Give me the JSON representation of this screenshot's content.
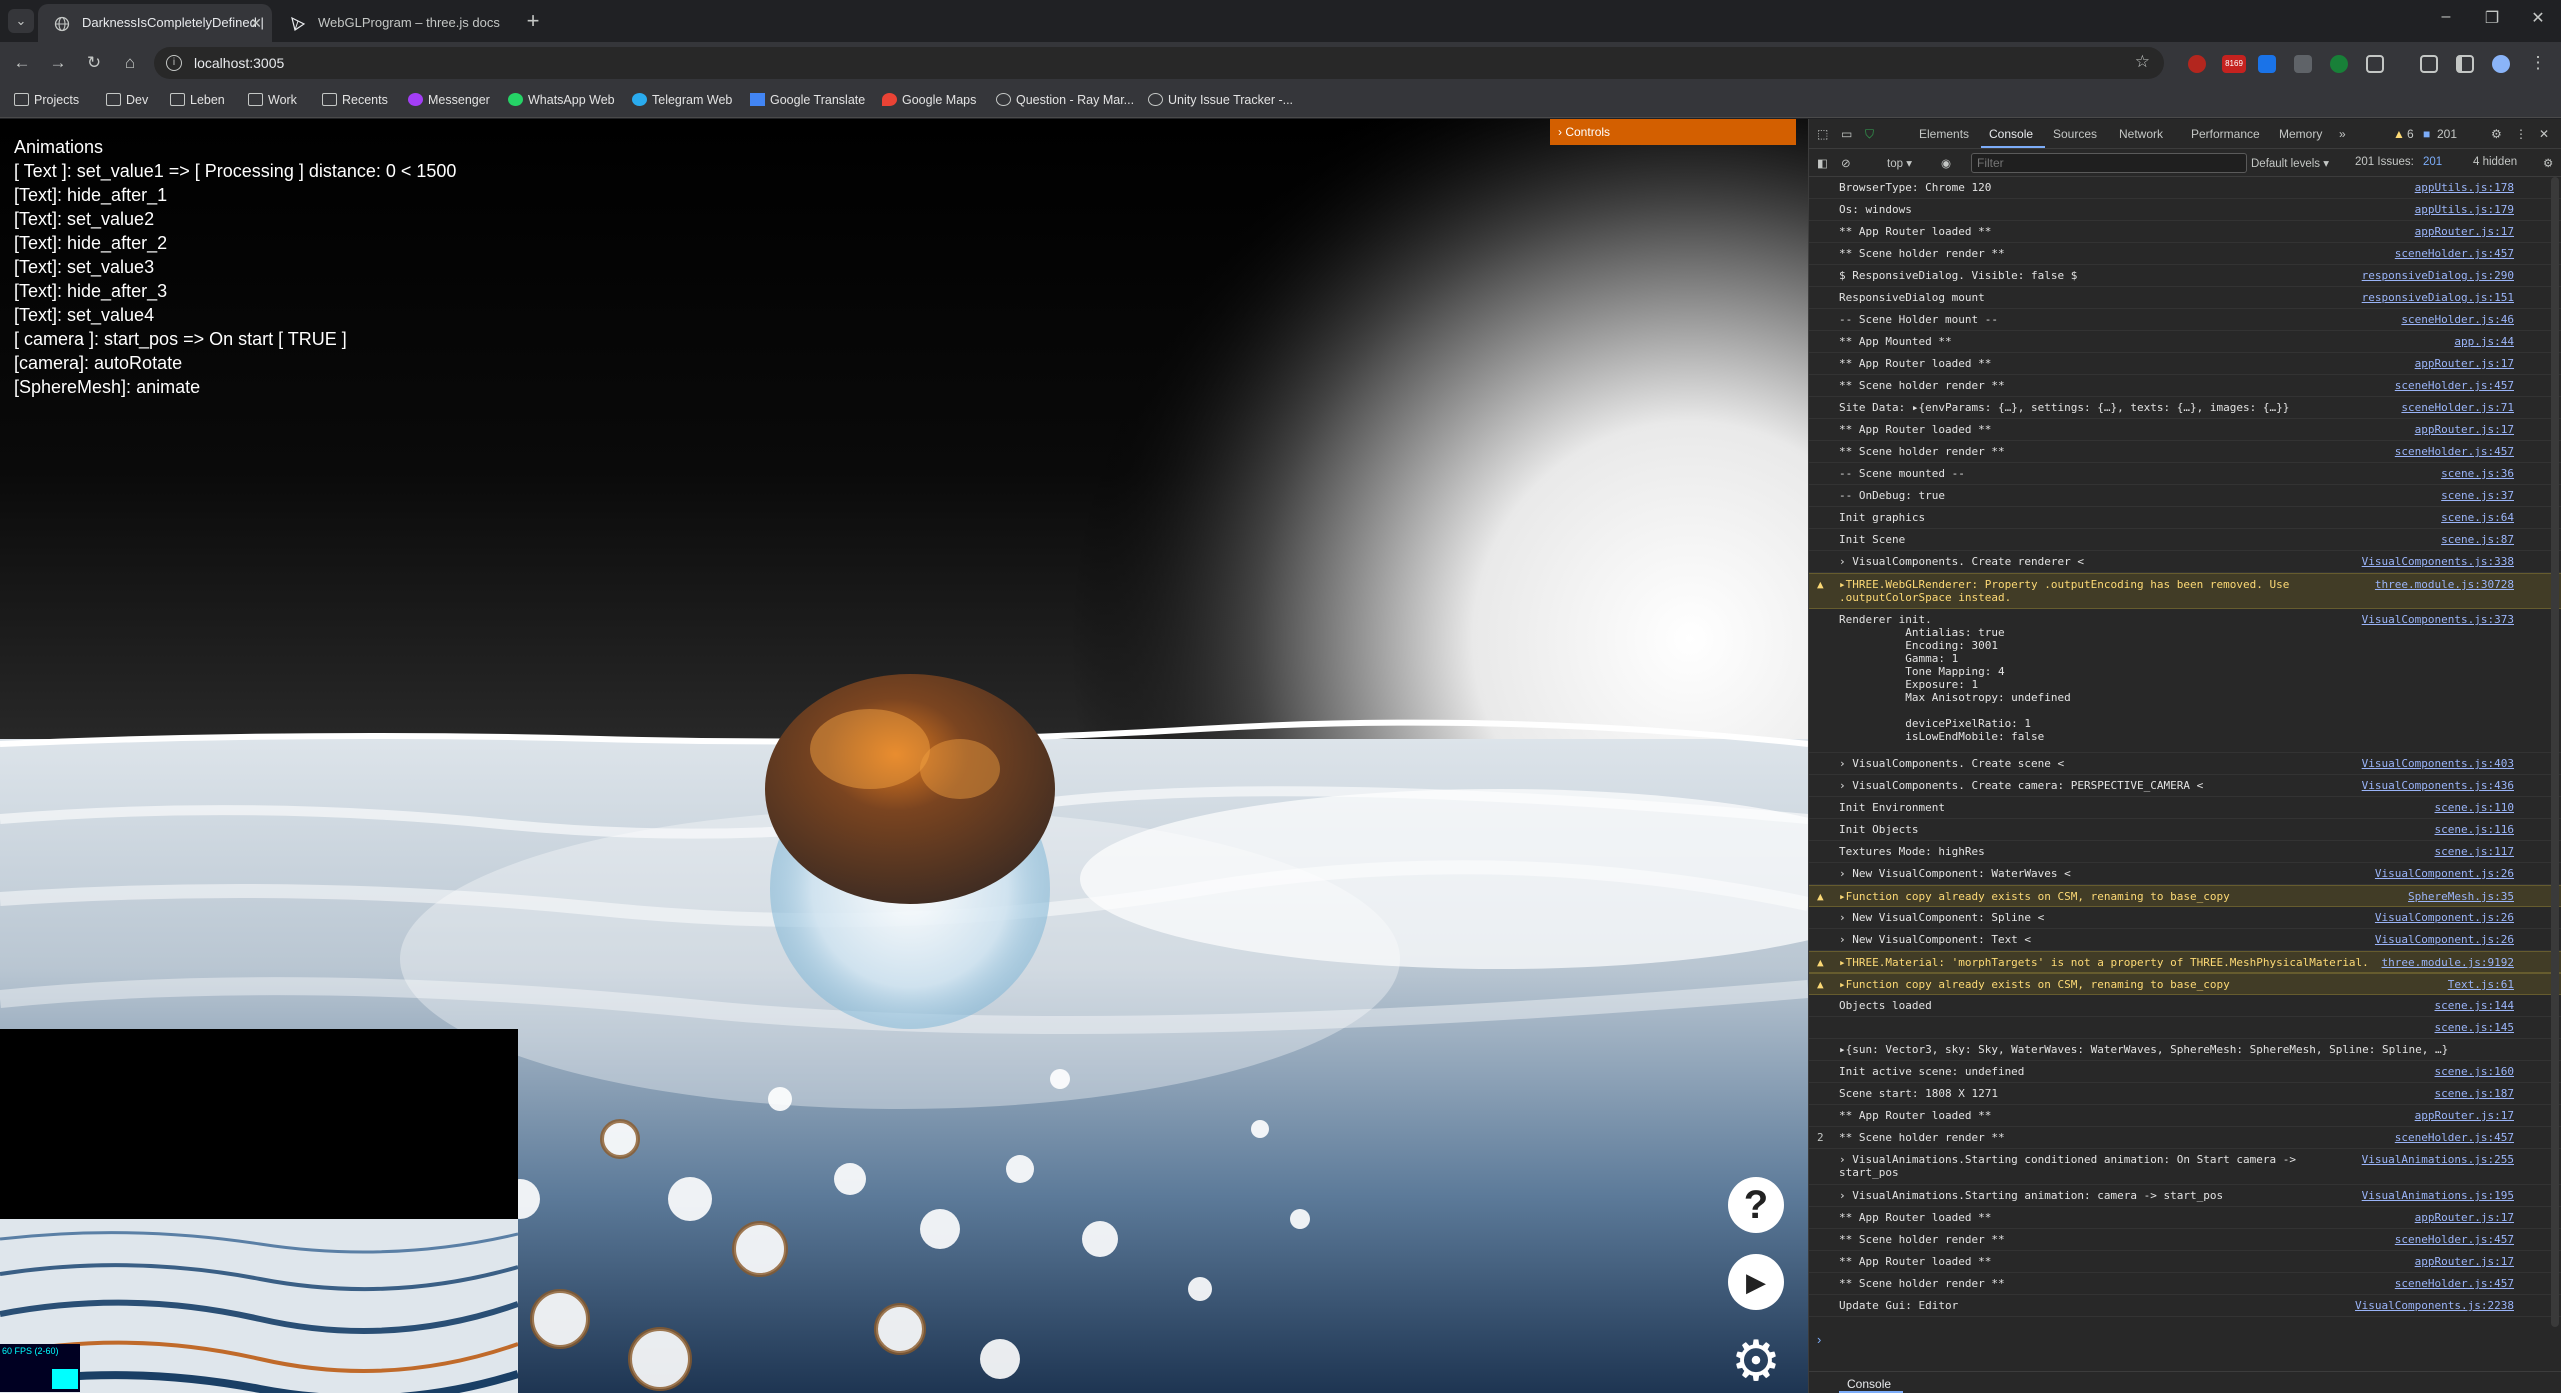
{
  "browser": {
    "tabs": [
      {
        "title": "DarknessIsCompletelyDefined |",
        "active": true
      },
      {
        "title": "WebGLProgram – three.js docs",
        "active": false
      }
    ],
    "url": "localhost:3005",
    "bookmarks": [
      {
        "label": "Projects",
        "icon": "folder-icon"
      },
      {
        "label": "Dev",
        "icon": "folder-icon"
      },
      {
        "label": "Leben",
        "icon": "folder-icon"
      },
      {
        "label": "Work",
        "icon": "folder-icon"
      },
      {
        "label": "Recents",
        "icon": "folder-icon"
      },
      {
        "label": "Messenger",
        "icon": "messenger-icon"
      },
      {
        "label": "WhatsApp Web",
        "icon": "whatsapp-icon"
      },
      {
        "label": "Telegram Web",
        "icon": "telegram-icon"
      },
      {
        "label": "Google Translate",
        "icon": "translate-icon"
      },
      {
        "label": "Google Maps",
        "icon": "maps-icon"
      },
      {
        "label": "Question - Ray Mar...",
        "icon": "stackexchange-icon"
      },
      {
        "label": "Unity Issue Tracker -...",
        "icon": "unity-icon"
      }
    ],
    "extension_badge": "8169"
  },
  "scene": {
    "animations": [
      "Animations",
      "[ Text ]: set_value1 => [ Processing ] distance: 0 < 1500",
      "[Text]: hide_after_1",
      "[Text]: set_value2",
      "[Text]: hide_after_2",
      "[Text]: set_value3",
      "[Text]: hide_after_3",
      "[Text]: set_value4",
      "[ camera ]: start_pos => On start [ TRUE ]",
      "[camera]: autoRotate",
      "[SphereMesh]: animate"
    ],
    "controls_label": "Controls",
    "fps_label": "60 FPS (2-60)",
    "fab_help": "?",
    "fab_play": "▶",
    "fab_settings": "⚙"
  },
  "devtools": {
    "tabs": [
      "Elements",
      "Console",
      "Sources",
      "Network",
      "Performance",
      "Memory"
    ],
    "more_tabs": "»",
    "warnings_count": "6",
    "issues_count": "201",
    "context": "top",
    "filter_placeholder": "Filter",
    "levels": "Default levels",
    "issues_label": "201 Issues:",
    "issues_badge": "201",
    "hidden_label": "4 hidden",
    "drawer_tab": "Console",
    "log": [
      {
        "msg": "BrowserType: Chrome 120",
        "src": "appUtils.js:178"
      },
      {
        "msg": "Os: windows",
        "src": "appUtils.js:179"
      },
      {
        "msg": "** App Router loaded **",
        "src": "appRouter.js:17"
      },
      {
        "msg": "** Scene holder render **",
        "src": "sceneHolder.js:457"
      },
      {
        "msg": "$ ResponsiveDialog. Visible: false $",
        "src": "responsiveDialog.js:290"
      },
      {
        "msg": "ResponsiveDialog mount",
        "src": "responsiveDialog.js:151"
      },
      {
        "msg": "-- Scene Holder mount --",
        "src": "sceneHolder.js:46"
      },
      {
        "msg": "** App Mounted **",
        "src": "app.js:44"
      },
      {
        "msg": "** App Router loaded **",
        "src": "appRouter.js:17"
      },
      {
        "msg": "** Scene holder render **",
        "src": "sceneHolder.js:457"
      },
      {
        "msg": "Site Data: ▸{envParams: {…}, settings: {…}, texts: {…}, images: {…}}",
        "src": "sceneHolder.js:71"
      },
      {
        "msg": "** App Router loaded **",
        "src": "appRouter.js:17"
      },
      {
        "msg": "** Scene holder render **",
        "src": "sceneHolder.js:457"
      },
      {
        "msg": "-- Scene mounted --",
        "src": "scene.js:36"
      },
      {
        "msg": "-- OnDebug: true",
        "src": "scene.js:37"
      },
      {
        "msg": "Init graphics",
        "src": "scene.js:64"
      },
      {
        "msg": "Init Scene",
        "src": "scene.js:87"
      },
      {
        "msg": "› VisualComponents. Create renderer <",
        "src": "VisualComponents.js:338"
      },
      {
        "msg": "▸THREE.WebGLRenderer: Property .outputEncoding has been removed. Use\n.outputColorSpace instead.",
        "src": "three.module.js:30728",
        "warn": true,
        "lines": 2
      },
      {
        "msg": "Renderer init.\n          Antialias: true\n          Encoding: 3001\n          Gamma: 1\n          Tone Mapping: 4\n          Exposure: 1\n          Max Anisotropy: undefined\n\n          devicePixelRatio: 1\n          isLowEndMobile: false",
        "src": "VisualComponents.js:373",
        "lines": 10
      },
      {
        "msg": "› VisualComponents. Create scene <",
        "src": "VisualComponents.js:403"
      },
      {
        "msg": "› VisualComponents. Create camera: PERSPECTIVE_CAMERA <",
        "src": "VisualComponents.js:436"
      },
      {
        "msg": "Init Environment",
        "src": "scene.js:110"
      },
      {
        "msg": "Init Objects",
        "src": "scene.js:116"
      },
      {
        "msg": "Textures Mode: highRes",
        "src": "scene.js:117"
      },
      {
        "msg": "› New VisualComponent: WaterWaves <",
        "src": "VisualComponent.js:26"
      },
      {
        "msg": "▸Function copy already exists on CSM, renaming to base_copy",
        "src": "SphereMesh.js:35",
        "warn": true
      },
      {
        "msg": "› New VisualComponent: Spline <",
        "src": "VisualComponent.js:26"
      },
      {
        "msg": "› New VisualComponent: Text <",
        "src": "VisualComponent.js:26"
      },
      {
        "msg": "▸THREE.Material: 'morphTargets' is not a property of THREE.MeshPhysicalMaterial.",
        "src": "three.module.js:9192",
        "warn": true
      },
      {
        "msg": "▸Function copy already exists on CSM, renaming to base_copy",
        "src": "Text.js:61",
        "warn": true
      },
      {
        "msg": "Objects loaded",
        "src": "scene.js:144"
      },
      {
        "msg": "",
        "src": "scene.js:145"
      },
      {
        "msg": "▸{sun: Vector3, sky: Sky, WaterWaves: WaterWaves, SphereMesh: SphereMesh, Spline: Spline, …}",
        "src": ""
      },
      {
        "msg": "Init active scene: undefined",
        "src": "scene.js:160"
      },
      {
        "msg": "Scene start: 1808 X 1271",
        "src": "scene.js:187"
      },
      {
        "msg": "** App Router loaded **",
        "src": "appRouter.js:17"
      },
      {
        "msg": "** Scene holder render **",
        "src": "sceneHolder.js:457",
        "count": "2"
      },
      {
        "msg": "› VisualAnimations.Starting conditioned animation: On Start camera ->\nstart_pos",
        "src": "VisualAnimations.js:255",
        "lines": 2
      },
      {
        "msg": "› VisualAnimations.Starting animation: camera -> start_pos",
        "src": "VisualAnimations.js:195"
      },
      {
        "msg": "** App Router loaded **",
        "src": "appRouter.js:17"
      },
      {
        "msg": "** Scene holder render **",
        "src": "sceneHolder.js:457"
      },
      {
        "msg": "** App Router loaded **",
        "src": "appRouter.js:17"
      },
      {
        "msg": "** Scene holder render **",
        "src": "sceneHolder.js:457"
      },
      {
        "msg": "Update Gui: Editor",
        "src": "VisualComponents.js:2238"
      }
    ]
  },
  "colors": {
    "controls": "#d35f00",
    "warn_bg": "#413c26",
    "link": "#9ab4f8"
  }
}
